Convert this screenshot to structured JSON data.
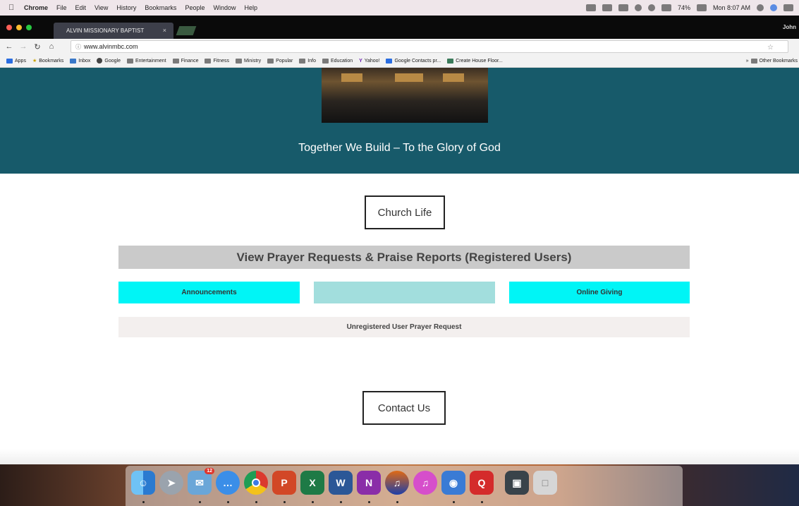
{
  "menubar": {
    "app_name": "Chrome",
    "menus": [
      "File",
      "Edit",
      "View",
      "History",
      "Bookmarks",
      "People",
      "Window",
      "Help"
    ],
    "battery": "74%",
    "clock": "Mon 8:07 AM"
  },
  "browser": {
    "tab_title": "ALVIN MISSIONARY BAPTIST",
    "tab_close": "×",
    "profile": "John",
    "url": "www.alvinmbc.com",
    "bookmarks": [
      "Apps",
      "Bookmarks",
      "Inbox",
      "Google",
      "Entertainment",
      "Finance",
      "Fitness",
      "Ministry",
      "Popular",
      "Info",
      "Education",
      "Yahoo!",
      "Google Contacts pr...",
      "Create House Floor..."
    ],
    "other_bookmarks": "Other Bookmarks"
  },
  "page": {
    "tagline": "Together We Build – To the Glory of God",
    "church_life": "Church Life",
    "prayer_bar": "View Prayer Requests & Praise Reports (Registered Users)",
    "buttons": {
      "announcements": "Announcements",
      "middle": "",
      "online_giving": "Online Giving"
    },
    "unregistered": "Unregistered User Prayer Request",
    "contact_us": "Contact Us"
  },
  "dock": {
    "mail_badge": "12",
    "icons": [
      "finder-icon",
      "launchpad-icon",
      "mail-icon",
      "messages-icon",
      "chrome-icon",
      "powerpoint-icon",
      "excel-icon",
      "word-icon",
      "onenote-icon",
      "audacity-icon",
      "itunes-icon",
      "screenshot-icon",
      "quicken-icon",
      "preview-icon",
      "trash-icon"
    ]
  },
  "colors": {
    "hero": "#175a6a",
    "cyan_button": "#00f5f6",
    "muted_button": "#a2dedd",
    "prayer_bar": "#cacaca"
  }
}
